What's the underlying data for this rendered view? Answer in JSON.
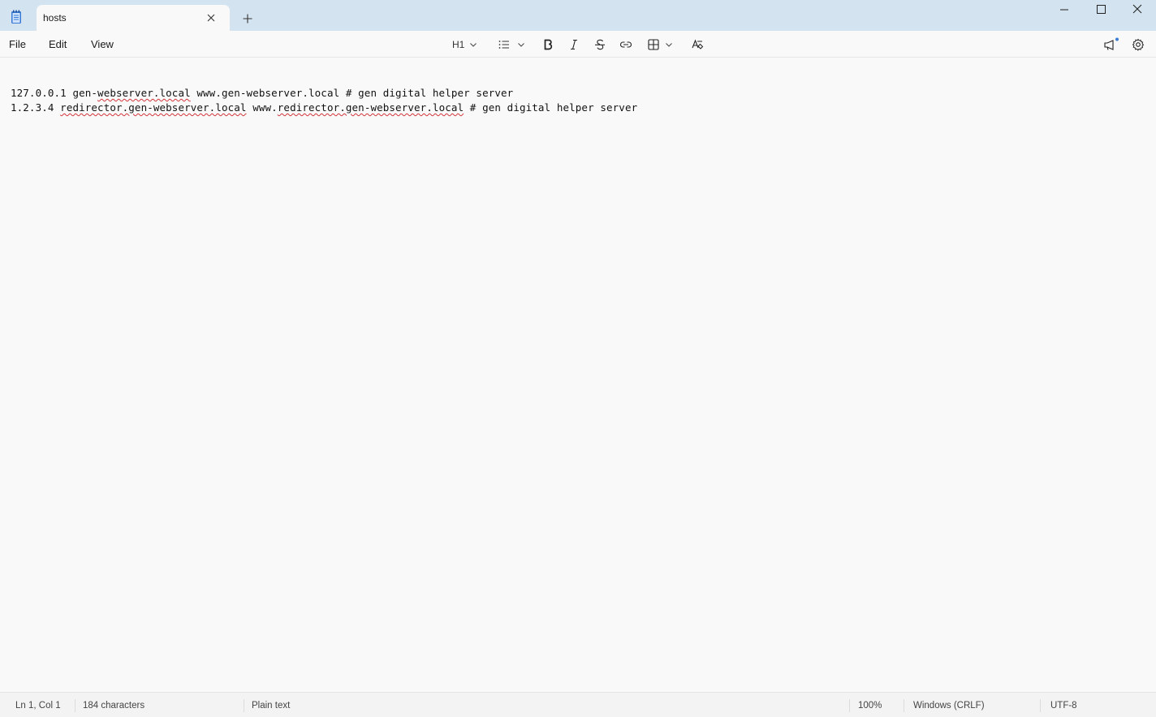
{
  "window": {
    "tab_title": "hosts",
    "new_tab_symbol": "+",
    "colors": {
      "titlebar": "#d3e3ef",
      "editor_bg": "#f9f9f9",
      "spell_error": "#d13438"
    }
  },
  "menu": {
    "file": "File",
    "edit": "Edit",
    "view": "View"
  },
  "toolbar": {
    "heading_label": "H1",
    "icons": [
      "list-icon",
      "bold-icon",
      "italic-icon",
      "strikethrough-icon",
      "link-icon",
      "table-icon",
      "clear-formatting-icon",
      "megaphone-icon",
      "gear-icon"
    ]
  },
  "editor": {
    "line1": {
      "a": "127.0.0.1 gen-",
      "b": "webserver.local",
      "c": " www.gen-webserver.local # gen digital helper server"
    },
    "line2": {
      "a": "1.2.3.4 ",
      "b": "redirector.gen-webserver.local",
      "c": " www.",
      "d": "redirector.gen-webserver.local",
      "e": " # gen digital helper server"
    }
  },
  "status": {
    "position": "Ln 1, Col 1",
    "characters": "184 characters",
    "format": "Plain text",
    "zoom": "100%",
    "line_ending": "Windows (CRLF)",
    "encoding": "UTF-8"
  }
}
